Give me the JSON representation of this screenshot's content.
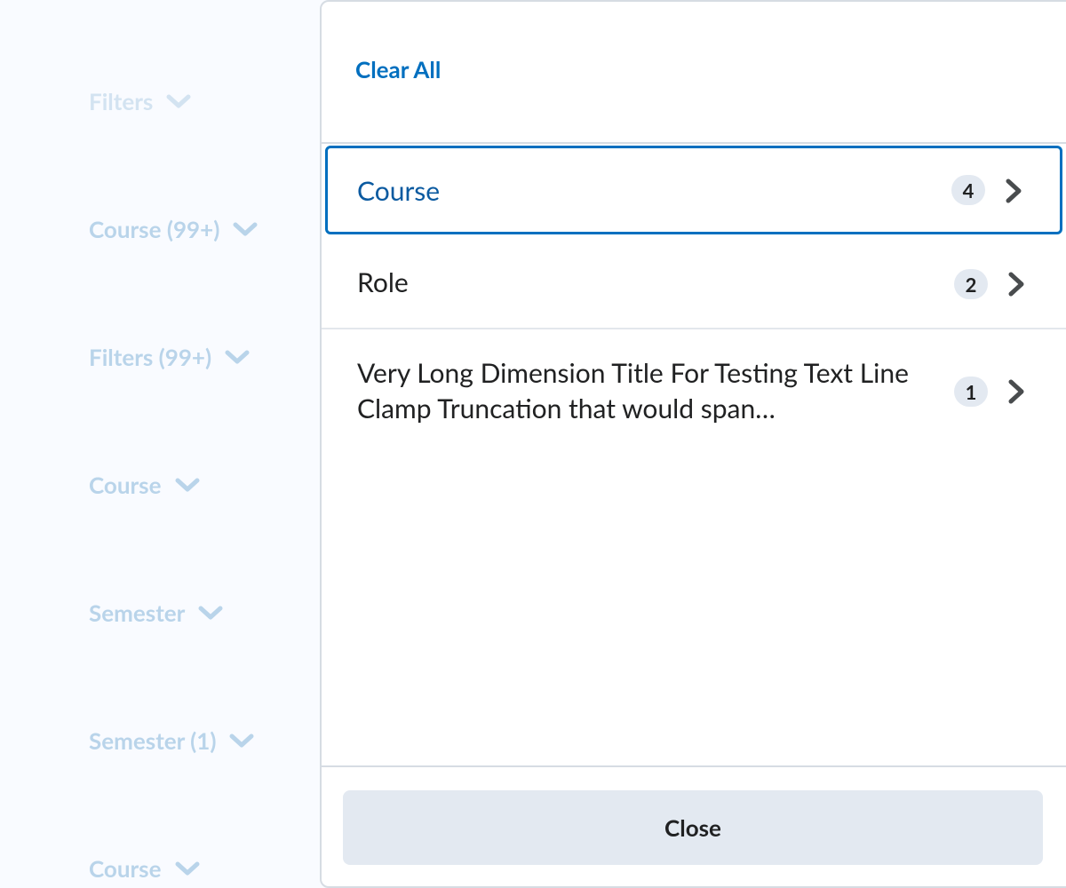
{
  "background_filters": [
    {
      "label": "Filters"
    },
    {
      "label": "Course (99+)"
    },
    {
      "label": "Filters (99+)"
    },
    {
      "label": "Course"
    },
    {
      "label": "Semester"
    },
    {
      "label": "Semester (1)"
    },
    {
      "label": "Course"
    }
  ],
  "panel": {
    "clear_all_label": "Clear All",
    "dimensions": [
      {
        "title": "Course",
        "count": "4",
        "selected": true
      },
      {
        "title": "Role",
        "count": "2",
        "selected": false
      },
      {
        "title": "Very Long Dimension Title For Testing Text Line Clamp Truncation that would span…",
        "count": "1",
        "selected": false
      }
    ],
    "close_label": "Close"
  },
  "colors": {
    "accent": "#006fbf",
    "selected_text": "#0b5aa0",
    "badge_bg": "#e3e9f1",
    "dimmed_text": "#b9d4ea"
  },
  "icons": {
    "dropdown": "chevron-down-icon",
    "drill_in": "chevron-right-icon"
  }
}
